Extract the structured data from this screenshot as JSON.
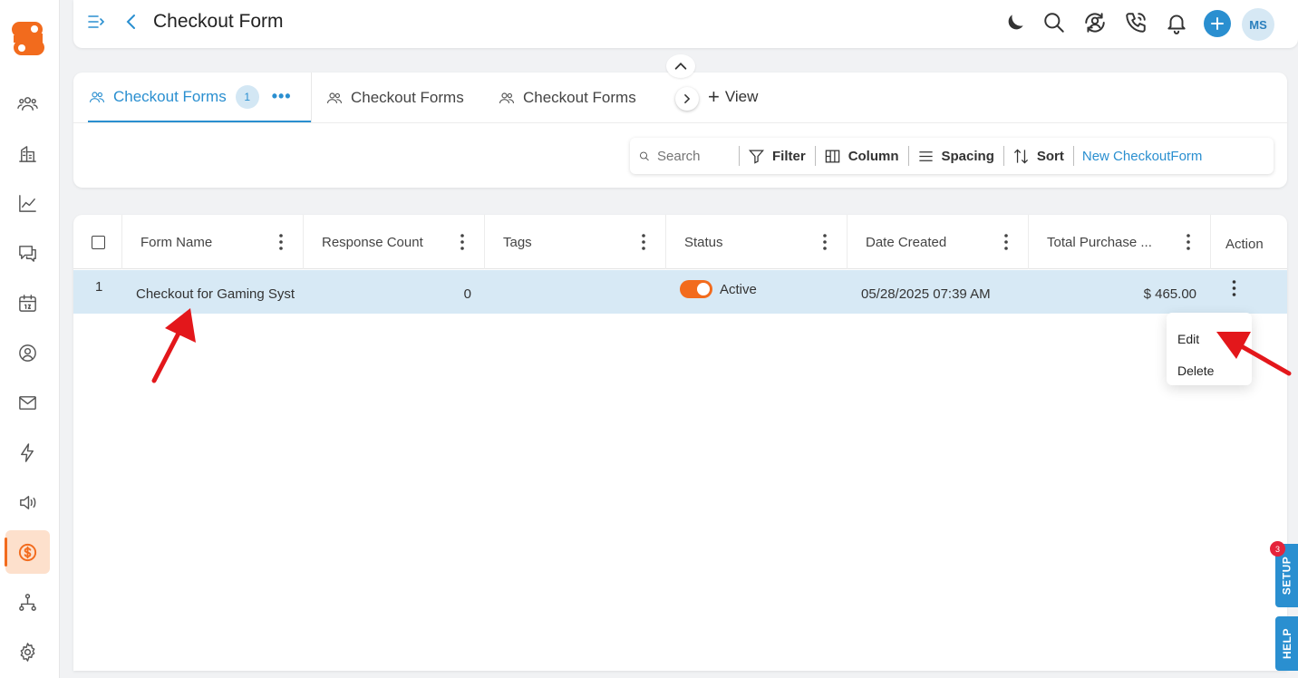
{
  "header": {
    "title": "Checkout Form",
    "avatar_initials": "MS"
  },
  "tabs": [
    {
      "label": "Checkout Forms",
      "badge": "1",
      "active": true
    },
    {
      "label": "Checkout Forms"
    },
    {
      "label": "Checkout Forms"
    }
  ],
  "add_view_label": "View",
  "toolbar": {
    "search_placeholder": "Search",
    "filter": "Filter",
    "column": "Column",
    "spacing": "Spacing",
    "sort": "Sort",
    "new_button": "New CheckoutForm"
  },
  "table": {
    "columns": [
      "Form Name",
      "Response Count",
      "Tags",
      "Status",
      "Date Created",
      "Total Purchase ...",
      "Action"
    ],
    "rows": [
      {
        "index": "1",
        "form_name": "Checkout for Gaming Syst",
        "response_count": "0",
        "tags": "",
        "status": "Active",
        "date_created": "05/28/2025 07:39 AM",
        "total_purchase": "$ 465.00"
      }
    ]
  },
  "action_menu": {
    "edit": "Edit",
    "delete": "Delete"
  },
  "side_tabs": {
    "setup": "SETUP",
    "setup_badge": "3",
    "help": "HELP"
  },
  "colors": {
    "brand_orange": "#f26b1d",
    "accent_blue": "#2a8fd0",
    "row_highlight": "#d7e9f5",
    "annotation_red": "#e3171b"
  }
}
